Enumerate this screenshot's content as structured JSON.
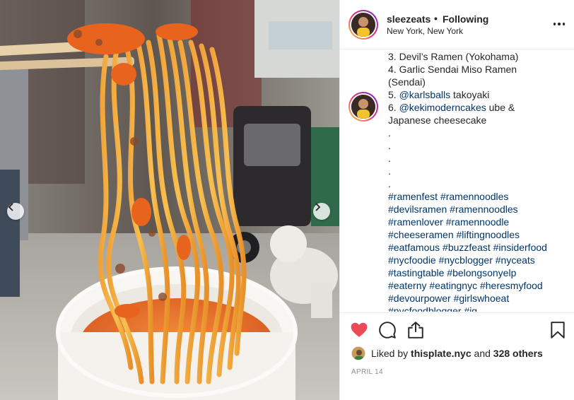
{
  "post": {
    "username": "sleezeats",
    "separator": "•",
    "follow_status": "Following",
    "location": "New York, New York"
  },
  "caption": {
    "lines": [
      {
        "text": "3. Devil’s Ramen (Yokohama)"
      },
      {
        "text": "4. Garlic Sendai Miso Ramen"
      },
      {
        "text": "(Sendai)"
      },
      {
        "text_mention": "@karlsballs",
        "text_rest": " takoyaki"
      },
      {
        "text_mention": "@kekimoderncakes",
        "text_rest": " ube &"
      },
      {
        "text": "Japanese cheesecake"
      },
      {
        "text": "."
      },
      {
        "text": "."
      },
      {
        "text": "."
      },
      {
        "text": "."
      },
      {
        "text": "."
      }
    ],
    "line_labels": {
      "five": "5. ",
      "six": "6. "
    },
    "hashtag_lines": [
      "#ramenfest #ramennoodles",
      "#devilsramen #ramennoodles",
      "#ramenlover #ramennoodle",
      "#cheeseramen #liftingnoodles",
      "#eatfamous #buzzfeast #insiderfood",
      "#nycfoodie #nycblogger #nyceats",
      "#tastingtable #belongsonyelp",
      "#eaterny #eatingnyc #heresmyfood",
      "#devourpower #girlswhoeat",
      "#nycfoodblogger #ig"
    ]
  },
  "actions": {
    "like_icon": "heart-filled-icon",
    "comment_icon": "comment-icon",
    "share_icon": "share-icon",
    "save_icon": "bookmark-icon",
    "like_color": "#ed4956"
  },
  "likes": {
    "prefix": "Liked by ",
    "user": "thisplate.nyc",
    "middle": " and ",
    "count": "328 others"
  },
  "date": "APRIL 14",
  "carousel": {
    "prev_icon": "chevron-left-icon",
    "next_icon": "chevron-right-icon"
  },
  "colors": {
    "link": "#003569",
    "text": "#262626",
    "muted": "#8e8e8e",
    "divider": "#efefef"
  }
}
